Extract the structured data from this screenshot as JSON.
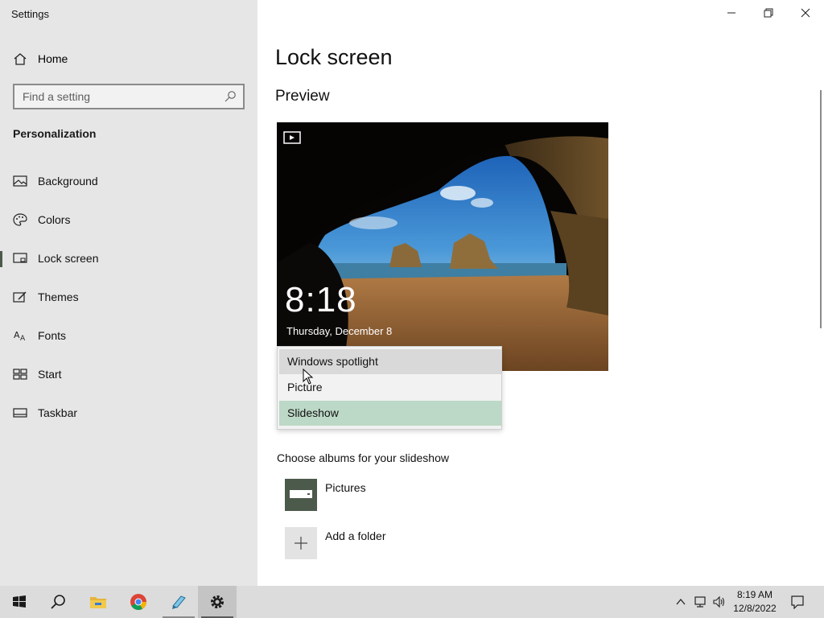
{
  "window": {
    "app_title": "Settings",
    "controls": [
      "minimize-icon",
      "restore-icon",
      "close-icon"
    ]
  },
  "sidebar": {
    "home_label": "Home",
    "search_placeholder": "Find a setting",
    "section_title": "Personalization",
    "items": [
      {
        "label": "Background",
        "icon": "picture-icon"
      },
      {
        "label": "Colors",
        "icon": "palette-icon"
      },
      {
        "label": "Lock screen",
        "icon": "lock-screen-icon",
        "active": true
      },
      {
        "label": "Themes",
        "icon": "brush-icon"
      },
      {
        "label": "Fonts",
        "icon": "font-icon"
      },
      {
        "label": "Start",
        "icon": "start-grid-icon"
      },
      {
        "label": "Taskbar",
        "icon": "taskbar-icon"
      }
    ]
  },
  "main": {
    "title": "Lock screen",
    "preview_heading": "Preview",
    "preview": {
      "time": "8:18",
      "date": "Thursday, December 8"
    },
    "background_dropdown": {
      "options": [
        "Windows spotlight",
        "Picture",
        "Slideshow"
      ],
      "hovered": "Windows spotlight",
      "selected": "Slideshow"
    },
    "albums_label": "Choose albums for your slideshow",
    "album_name": "Pictures",
    "add_folder_label": "Add a folder"
  },
  "taskbar": {
    "apps": [
      "start-icon",
      "search-icon",
      "file-explorer-icon",
      "chrome-icon",
      "notepad-icon",
      "settings-gear-icon"
    ],
    "clock_time": "8:19 AM",
    "clock_date": "12/8/2022"
  },
  "colors": {
    "sidebar_bg": "#e6e6e6",
    "accent": "#4c5a4c",
    "selected_option": "#bcd8c6",
    "taskbar_bg": "#dcdcdc"
  }
}
